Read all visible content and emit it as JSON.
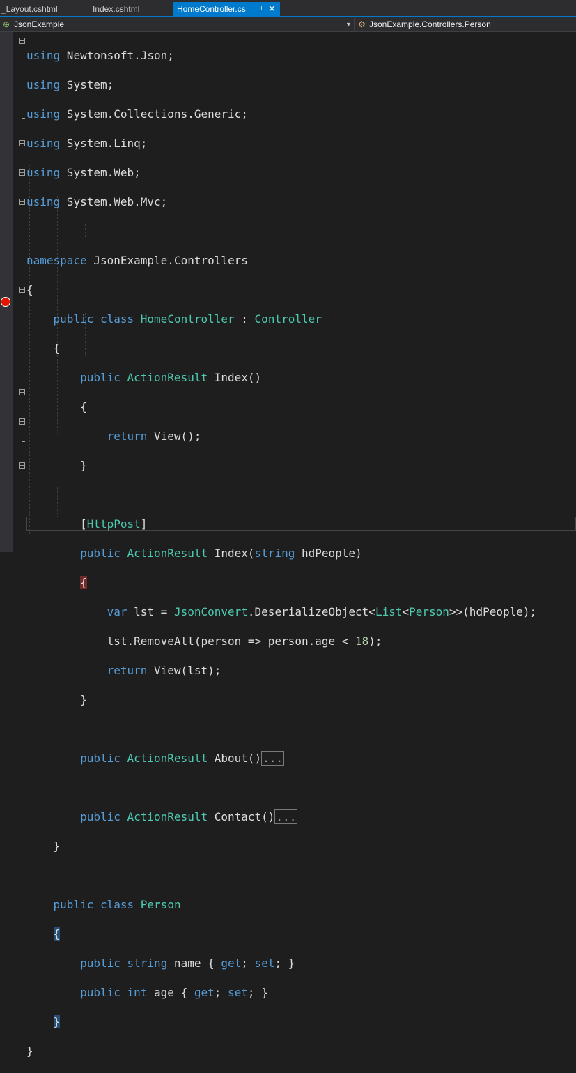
{
  "tabs": [
    {
      "label": "_Layout.cshtml"
    },
    {
      "label": "Index.cshtml"
    },
    {
      "label": "HomeController.cs",
      "pin": "⊣",
      "close": "✕"
    }
  ],
  "nav": {
    "project": "JsonExample",
    "scope": "JsonExample.Controllers.Person"
  },
  "code_lines": [
    "using Newtonsoft.Json;",
    "using System;",
    "using System.Collections.Generic;",
    "using System.Linq;",
    "using System.Web;",
    "using System.Web.Mvc;",
    "",
    "namespace JsonExample.Controllers",
    "{",
    "    public class HomeController : Controller",
    "    {",
    "        public ActionResult Index()",
    "        {",
    "            return View();",
    "        }",
    "",
    "        [HttpPost]",
    "        public ActionResult Index(string hdPeople)",
    "        {",
    "            var lst = JsonConvert.DeserializeObject<List<Person>>(hdPeople);",
    "            lst.RemoveAll(person => person.age < 18);",
    "            return View(lst);",
    "        }",
    "",
    "        public ActionResult About()...",
    "",
    "        public ActionResult Contact()...",
    "    }",
    "",
    "    public class Person",
    "    {",
    "        public string name { get; set; }",
    "        public int age { get; set; }",
    "    }",
    "}"
  ],
  "colors": {
    "keyword": "#569cd6",
    "type": "#4ec9b0",
    "text": "#dcdcdc",
    "accent": "#007acc",
    "breakpoint": "#e51400"
  }
}
